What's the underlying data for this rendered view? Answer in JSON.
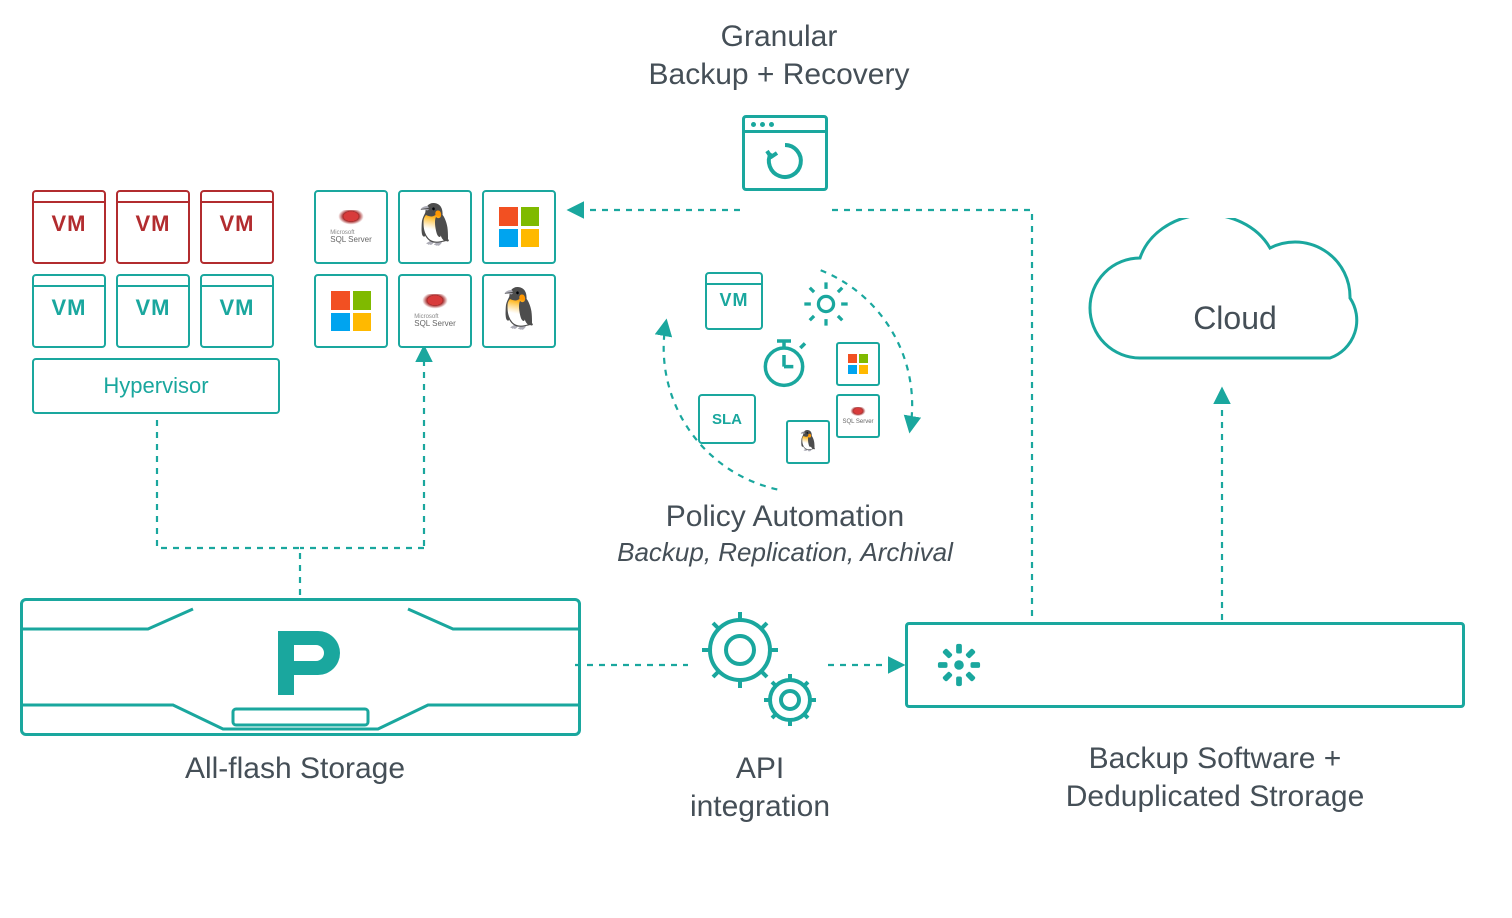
{
  "header": {
    "line1": "Granular",
    "line2": "Backup + Recovery"
  },
  "vm_label": "VM",
  "hypervisor_label": "Hypervisor",
  "sql_label": "SQL Server",
  "microsoft_prefix": "Microsoft",
  "policy": {
    "title": "Policy Automation",
    "subtitle": "Backup, Replication, Archival",
    "sla": "SLA",
    "vm": "VM"
  },
  "cloud_label": "Cloud",
  "storage_label": "All-flash Storage",
  "api": {
    "line1": "API",
    "line2": "integration"
  },
  "backup": {
    "line1": "Backup Software +",
    "line2": "Deduplicated Strorage"
  },
  "colors": {
    "teal": "#1aa79e",
    "red": "#b22c2f"
  }
}
